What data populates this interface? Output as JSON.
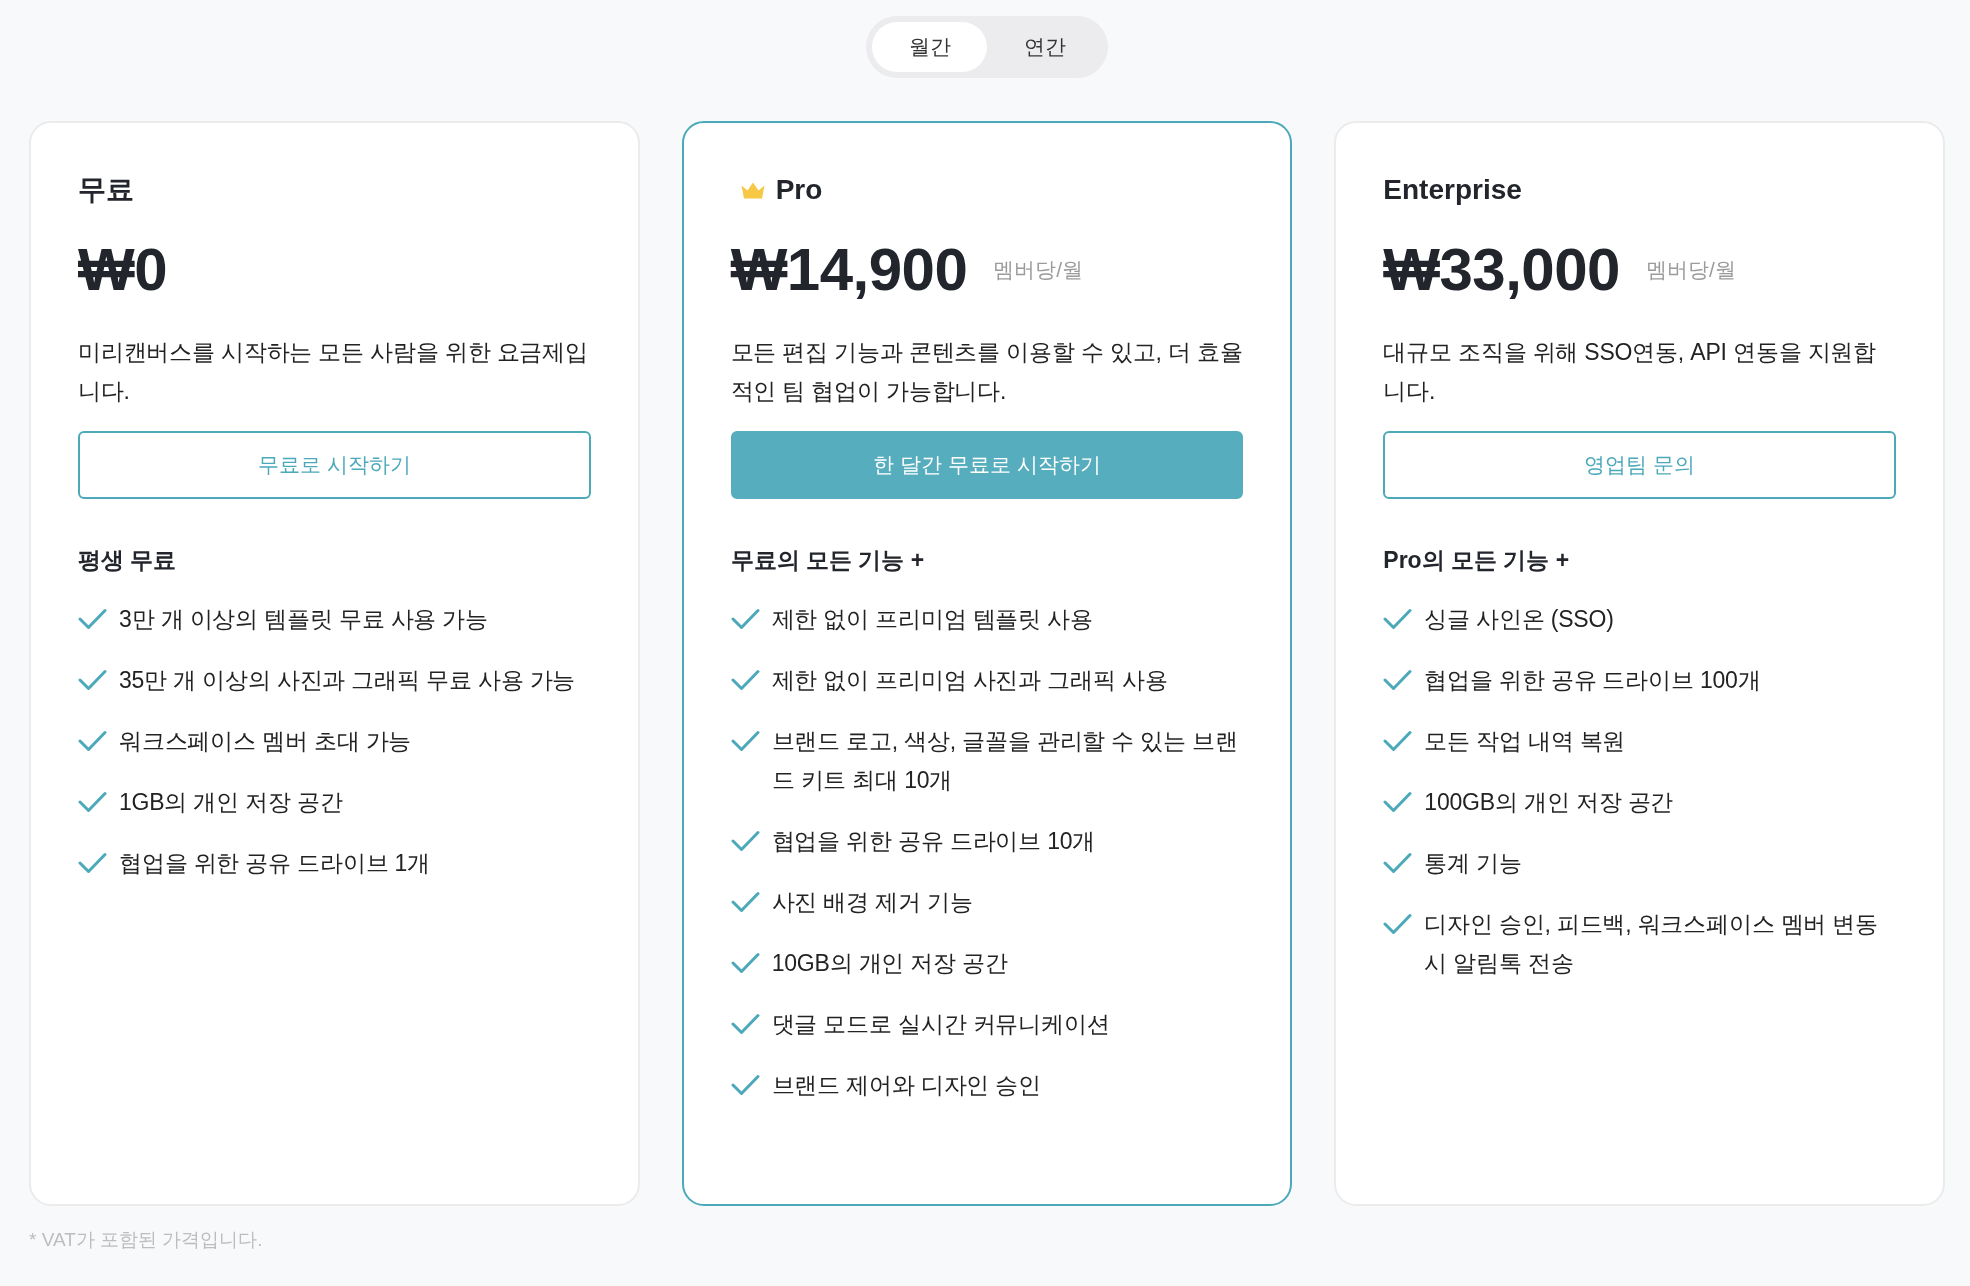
{
  "billing_toggle": [
    {
      "label": "월간",
      "selected": true
    },
    {
      "label": "연간",
      "selected": false
    }
  ],
  "plans": [
    {
      "name": "무료",
      "featured": false,
      "price": "₩0",
      "description": "미리캔버스를 시작하는 모든 사람을 위한 요금제입니다.",
      "button": {
        "label": "무료로 시작하기",
        "kind": "outline"
      },
      "features_heading": "평생 무료",
      "features": [
        "3만 개 이상의 템플릿 무료 사용 가능",
        "35만 개 이상의 사진과 그래픽 무료 사용 가능",
        "워크스페이스 멤버 초대 가능",
        "1GB의 개인 저장 공간",
        "협업을 위한 공유 드라이브 1개"
      ]
    },
    {
      "name": "Pro",
      "featured": true,
      "price": "₩14,900",
      "price_unit": "멤버당/월",
      "description": "모든 편집 기능과 콘텐츠를 이용할 수 있고, 더 효율적인 팀 협업이 가능합니다.",
      "button": {
        "label": "한 달간 무료로 시작하기",
        "kind": "filled"
      },
      "features_heading": "무료의 모든 기능 +",
      "features": [
        "제한 없이 프리미엄 템플릿 사용",
        "제한 없이 프리미엄 사진과 그래픽 사용",
        "브랜드 로고, 색상, 글꼴을 관리할 수 있는 브랜드 키트 최대 10개",
        "협업을 위한 공유 드라이브 10개",
        "사진 배경 제거 기능",
        "10GB의 개인 저장 공간",
        "댓글 모드로 실시간 커뮤니케이션",
        "브랜드 제어와 디자인 승인"
      ]
    },
    {
      "name": "Enterprise",
      "featured": false,
      "price": "₩33,000",
      "price_unit": "멤버당/월",
      "description": "대규모 조직을 위해 SSO연동, API 연동을 지원합니다.",
      "button": {
        "label": "영업팀 문의",
        "kind": "outline"
      },
      "features_heading": "Pro의 모든 기능 +",
      "features": [
        "싱글 사인온 (SSO)",
        "협업을 위한 공유 드라이브 100개",
        "모든 작업 내역 복원",
        "100GB의 개인 저장 공간",
        "통계 기능",
        "디자인 승인, 피드백, 워크스페이스 멤버 변동 시 알림톡 전송"
      ]
    }
  ],
  "footnote": "* VAT가 포함된 가격입니다."
}
